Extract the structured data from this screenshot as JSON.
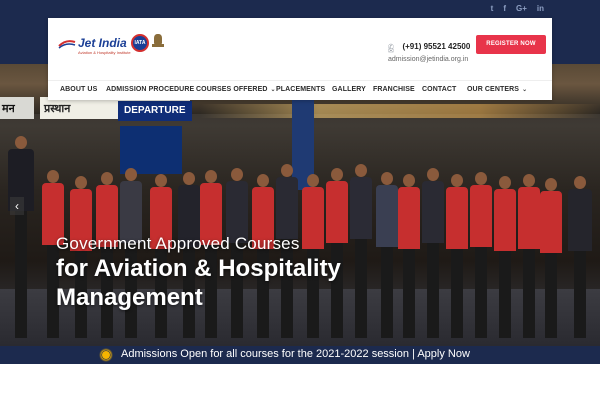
{
  "social": {
    "items": [
      {
        "icon": "twitter-icon",
        "glyph": "t"
      },
      {
        "icon": "facebook-icon",
        "glyph": "f"
      },
      {
        "icon": "google-plus-icon",
        "glyph": "G+"
      },
      {
        "icon": "linkedin-icon",
        "glyph": "in"
      }
    ]
  },
  "header": {
    "logo_text": "Jet India",
    "logo_tagline": "Aviation & Hospitality Institute",
    "iata_badge": "IATA",
    "phone_icon": "phone-icon",
    "phone": "(+91) 95521 42500",
    "email_icon": "envelope-icon",
    "email": "admission@jetindia.org.in",
    "register_label": "REGISTER NOW"
  },
  "nav": {
    "items": [
      {
        "label": "ABOUT US",
        "caret": ""
      },
      {
        "label": "ADMISSION PROCEDURE",
        "caret": ""
      },
      {
        "label": "COURSES OFFERED",
        "caret": "⌄"
      },
      {
        "label": "PLACEMENTS",
        "caret": ""
      },
      {
        "label": "GALLERY",
        "caret": ""
      },
      {
        "label": "FRANCHISE",
        "caret": ""
      },
      {
        "label": "CONTACT",
        "caret": ""
      },
      {
        "label": "OUR CENTERS",
        "caret": "⌄"
      }
    ]
  },
  "hero": {
    "scene_sign_hindi": "मन",
    "scene_sign_hindi2": "प्रस्थान",
    "scene_sign_departure": "DEPARTURE",
    "subtitle": "Government Approved Courses",
    "title_line1": "for Aviation & Hospitality",
    "title_line2": "Management",
    "prev_arrow": "‹",
    "next_arrow": "›"
  },
  "announcement": {
    "icon": "sun-icon",
    "text": "Admissions Open for all courses for the 2021-2022 session | Apply Now"
  },
  "colors": {
    "navy": "#1c2a4e",
    "accent_red": "#e8344a",
    "brand_blue": "#1b3f96"
  }
}
